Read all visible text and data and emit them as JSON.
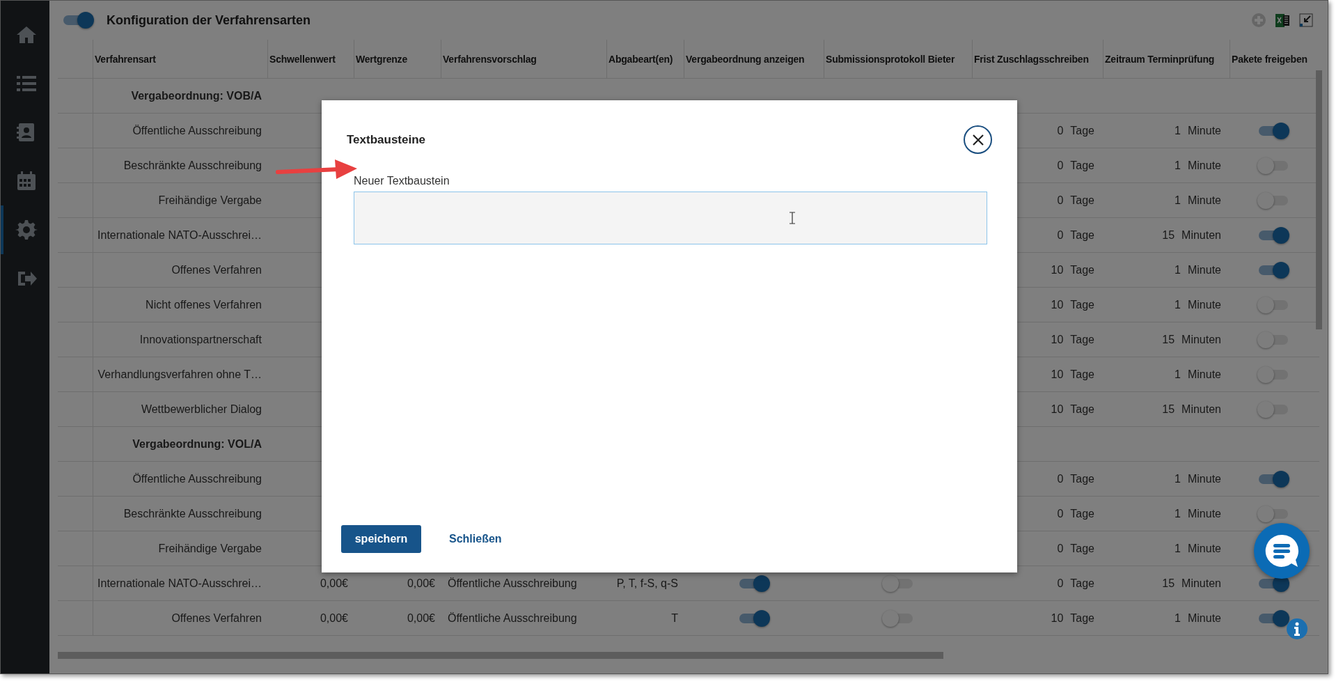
{
  "sidebar": {
    "items": [
      {
        "selected": false
      },
      {
        "selected": false
      },
      {
        "selected": false
      },
      {
        "selected": false
      },
      {
        "selected": true
      },
      {
        "selected": false
      }
    ]
  },
  "header": {
    "title": "Konfiguration der Verfahrensarten",
    "toggle_on": true
  },
  "table": {
    "columns": [
      "Verfahrensart",
      "Schwellenwert",
      "Wertgrenze",
      "Verfahrensvorschlag",
      "Abgabeart(en)",
      "Vergabeordnung anzeigen",
      "Submissionsprotokoll Bieter",
      "Frist Zuschlagsschreiben",
      "Zeitraum Terminprüfung",
      "Pakete freigeben"
    ],
    "rows": [
      {
        "kind": "group",
        "label": "Vergabeordnung: VOB/A"
      },
      {
        "kind": "item",
        "name": "Öffentliche Ausschreibung",
        "frist": "0",
        "frist_unit": "Tage",
        "zeitraum": "1",
        "zeitraum_unit": "Minute",
        "pakete_on": true
      },
      {
        "kind": "item",
        "name": "Beschränkte Ausschreibung",
        "frist": "0",
        "frist_unit": "Tage",
        "zeitraum": "1",
        "zeitraum_unit": "Minute",
        "pakete_on": false
      },
      {
        "kind": "item",
        "name": "Freihändige Vergabe",
        "frist": "0",
        "frist_unit": "Tage",
        "zeitraum": "1",
        "zeitraum_unit": "Minute",
        "pakete_on": false
      },
      {
        "kind": "item",
        "name": "Internationale NATO-Ausschrei…",
        "frist": "0",
        "frist_unit": "Tage",
        "zeitraum": "15",
        "zeitraum_unit": "Minuten",
        "pakete_on": true
      },
      {
        "kind": "item",
        "name": "Offenes Verfahren",
        "frist": "10",
        "frist_unit": "Tage",
        "zeitraum": "1",
        "zeitraum_unit": "Minute",
        "pakete_on": true
      },
      {
        "kind": "item",
        "name": "Nicht offenes Verfahren",
        "frist": "10",
        "frist_unit": "Tage",
        "zeitraum": "1",
        "zeitraum_unit": "Minute",
        "pakete_on": false
      },
      {
        "kind": "item",
        "name": "Innovationspartnerschaft",
        "frist": "10",
        "frist_unit": "Tage",
        "zeitraum": "15",
        "zeitraum_unit": "Minuten",
        "pakete_on": false
      },
      {
        "kind": "item",
        "name": "Verhandlungsverfahren ohne T…",
        "frist": "10",
        "frist_unit": "Tage",
        "zeitraum": "1",
        "zeitraum_unit": "Minute",
        "pakete_on": false
      },
      {
        "kind": "item",
        "name": "Wettbewerblicher Dialog",
        "frist": "10",
        "frist_unit": "Tage",
        "zeitraum": "15",
        "zeitraum_unit": "Minuten",
        "pakete_on": false
      },
      {
        "kind": "group",
        "label": "Vergabeordnung: VOL/A"
      },
      {
        "kind": "item",
        "name": "Öffentliche Ausschreibung",
        "frist": "0",
        "frist_unit": "Tage",
        "zeitraum": "1",
        "zeitraum_unit": "Minute",
        "pakete_on": true
      },
      {
        "kind": "item",
        "name": "Beschränkte Ausschreibung",
        "frist": "0",
        "frist_unit": "Tage",
        "zeitraum": "1",
        "zeitraum_unit": "Minute",
        "pakete_on": false
      },
      {
        "kind": "item",
        "name": "Freihändige Vergabe",
        "frist": "0",
        "frist_unit": "Tage",
        "zeitraum": "1",
        "zeitraum_unit": "Minute"
      },
      {
        "kind": "item",
        "name": "Internationale NATO-Ausschrei…",
        "schwellenwert": "0,00€",
        "wertgrenze": "0,00€",
        "vorschlag": "Öffentliche Ausschreibung",
        "abgabeart": "P, T, f-S, q-S",
        "vergabeordnung_on": true,
        "submission_on": false,
        "frist": "0",
        "frist_unit": "Tage",
        "zeitraum": "15",
        "zeitraum_unit": "Minuten",
        "pakete_on": true
      },
      {
        "kind": "item",
        "name": "Offenes Verfahren",
        "schwellenwert": "0,00€",
        "wertgrenze": "0,00€",
        "vorschlag": "Öffentliche Ausschreibung",
        "abgabeart": "T",
        "vergabeordnung_on": true,
        "submission_on": false,
        "frist": "10",
        "frist_unit": "Tage",
        "zeitraum": "1",
        "zeitraum_unit": "Minute",
        "pakete_on": true
      }
    ]
  },
  "modal": {
    "title": "Textbausteine",
    "field_label": "Neuer Textbaustein",
    "save_button": "speichern",
    "close_link": "Schließen"
  }
}
